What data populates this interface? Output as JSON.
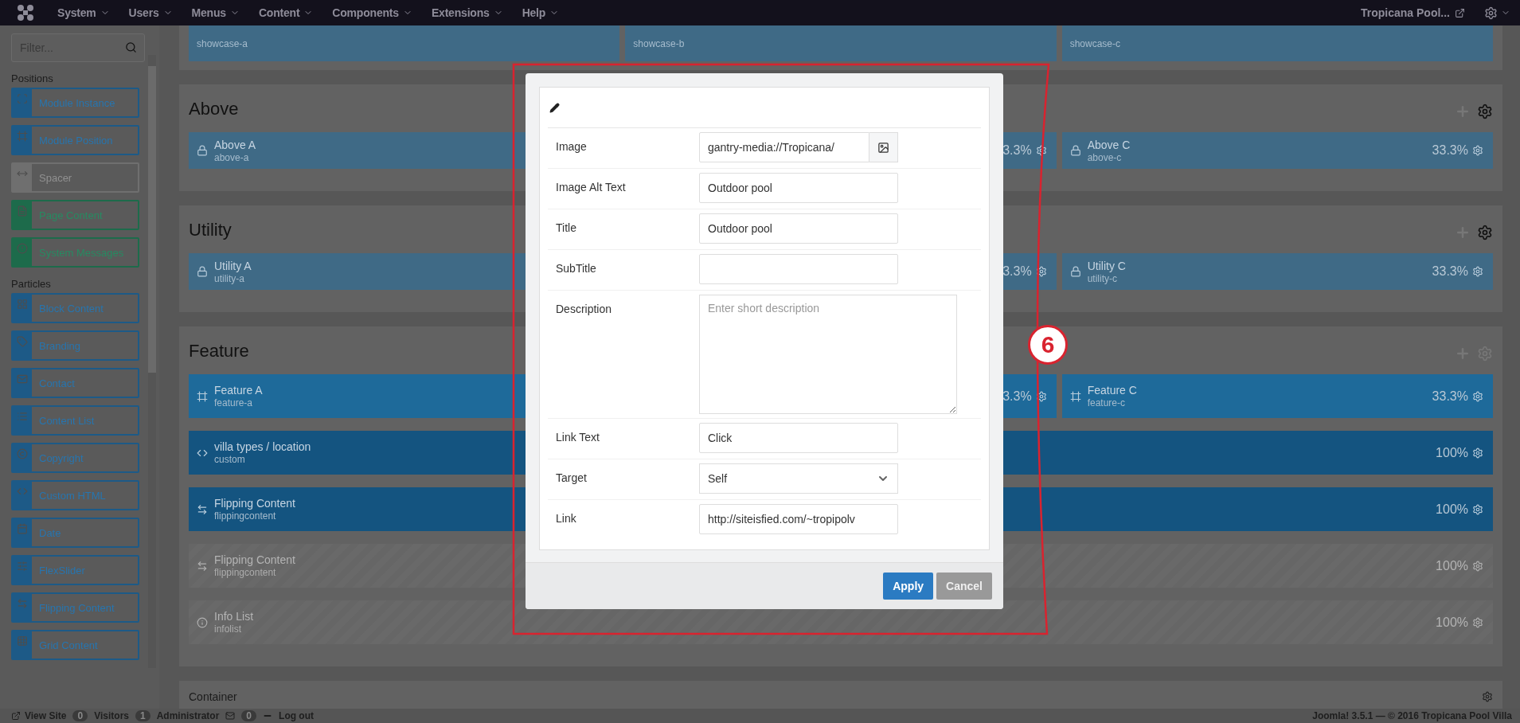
{
  "topbar": {
    "menus": [
      "System",
      "Users",
      "Menus",
      "Content",
      "Components",
      "Extensions",
      "Help"
    ],
    "site": "Tropicana Pool..."
  },
  "sidebar": {
    "filter": {
      "placeholder": "Filter..."
    },
    "groups": [
      {
        "title": "Positions",
        "items": [
          {
            "label": "Module Instance",
            "color": "#1d5a87"
          },
          {
            "label": "Module Position",
            "color": "#1d5a87"
          },
          {
            "label": "Spacer",
            "color": "#6f6f6f"
          },
          {
            "label": "Page Content",
            "color": "#1d6b4b"
          },
          {
            "label": "System Messages",
            "color": "#1d6b4b"
          }
        ]
      },
      {
        "title": "Particles",
        "items": [
          {
            "label": "Block Content",
            "color": "#1d5a87"
          },
          {
            "label": "Branding",
            "color": "#1d5a87"
          },
          {
            "label": "Contact",
            "color": "#1d5a87"
          },
          {
            "label": "Content List",
            "color": "#1d5a87"
          },
          {
            "label": "Copyright",
            "color": "#1d5a87"
          },
          {
            "label": "Custom HTML",
            "color": "#1d5a87"
          },
          {
            "label": "Date",
            "color": "#1d5a87"
          },
          {
            "label": "FlexSlider",
            "color": "#1d5a87"
          },
          {
            "label": "Flipping Content",
            "color": "#1d5a87"
          },
          {
            "label": "Grid Content",
            "color": "#1d5a87"
          }
        ]
      }
    ]
  },
  "sections": [
    {
      "kind": "cut",
      "rows": [
        {
          "cells": [
            {
              "kind": "locked",
              "id": "showcase-a"
            },
            {
              "kind": "locked",
              "id": "showcase-b"
            },
            {
              "kind": "locked",
              "id": "showcase-c"
            }
          ]
        }
      ]
    },
    {
      "kind": "full",
      "title": "Above",
      "rows": [
        {
          "cells": [
            {
              "kind": "locked",
              "name": "Above A",
              "id": "above-a"
            },
            {
              "kind": "locked",
              "percent": "3.3%"
            },
            {
              "kind": "locked",
              "name": "Above C",
              "id": "above-c",
              "percent": "33.3%"
            }
          ]
        }
      ]
    },
    {
      "kind": "full",
      "title": "Utility",
      "rows": [
        {
          "cells": [
            {
              "kind": "locked",
              "name": "Utility A",
              "id": "utility-a"
            },
            {
              "kind": "locked",
              "percent": "3.3%"
            },
            {
              "kind": "locked",
              "name": "Utility C",
              "id": "utility-c",
              "percent": "33.3%"
            }
          ]
        }
      ]
    },
    {
      "kind": "full",
      "title": "Feature",
      "rows": [
        {
          "cells": [
            {
              "kind": "position",
              "name": "Feature A",
              "id": "feature-a",
              "disabled": false
            },
            {
              "kind": "position",
              "percent": "3.3%",
              "disabled": false
            },
            {
              "kind": "position",
              "name": "Feature C",
              "id": "feature-c",
              "percent": "33.3%",
              "disabled": false
            }
          ]
        },
        {
          "cells": [
            {
              "kind": "custom",
              "name": "villa types / location",
              "id": "custom",
              "percent": "100%",
              "disabled": false
            }
          ]
        },
        {
          "cells": [
            {
              "kind": "flipping",
              "name": "Flipping Content",
              "id": "flippingcontent",
              "percent": "100%",
              "disabled": false
            }
          ]
        },
        {
          "cells": [
            {
              "kind": "flipping",
              "name": "Flipping Content",
              "id": "flippingcontent",
              "percent": "100%",
              "disabled": true
            }
          ]
        },
        {
          "cells": [
            {
              "kind": "info",
              "name": "Info List",
              "id": "infolist",
              "percent": "100%",
              "disabled": true
            }
          ]
        }
      ]
    }
  ],
  "container": {
    "title": "Container"
  },
  "modal": {
    "fields": [
      {
        "kind": "media",
        "label": "Image",
        "value": "gantry-media://Tropicana/"
      },
      {
        "kind": "text",
        "label": "Image Alt Text",
        "value": "Outdoor pool"
      },
      {
        "kind": "text",
        "label": "Title",
        "value": "Outdoor pool"
      },
      {
        "kind": "text",
        "label": "SubTitle"
      },
      {
        "kind": "textarea",
        "label": "Description",
        "placeholder": "Enter short description"
      },
      {
        "kind": "text",
        "label": "Link Text",
        "value": "Click"
      },
      {
        "kind": "select",
        "label": "Target",
        "value": "Self"
      },
      {
        "kind": "text",
        "label": "Link",
        "value": "http://siteisfied.com/~tropipolv"
      }
    ],
    "buttons": [
      {
        "label": "Apply",
        "kind": "primary"
      },
      {
        "label": "Cancel",
        "kind": "secondary"
      }
    ]
  },
  "annotation": {
    "label": "6"
  },
  "footer": {
    "view_site": "View Site",
    "visitors": {
      "count": "0",
      "label": "Visitors"
    },
    "admins": {
      "count": "1",
      "label": "Administrator"
    },
    "messages": {
      "count": "0"
    },
    "logout": "Log out",
    "version": "Joomla! 3.5.1 — © 2016 Tropicana Pool Villa"
  }
}
